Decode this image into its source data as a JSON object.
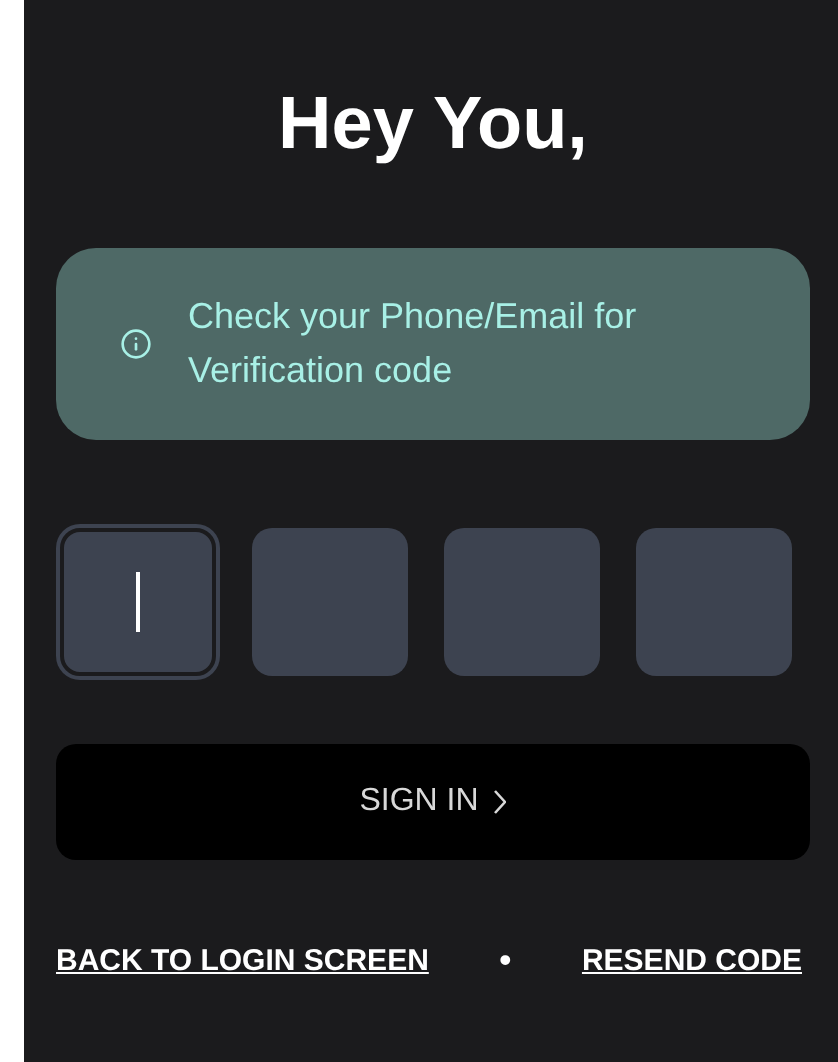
{
  "title": "Hey You,",
  "alert": {
    "text": "Check your Phone/Email for Verification code"
  },
  "code_boxes": [
    {
      "selected": true
    },
    {
      "selected": false
    },
    {
      "selected": false
    },
    {
      "selected": false
    }
  ],
  "sign_in_button": {
    "label": "SIGN IN"
  },
  "links": [
    {
      "label": "BACK TO LOGIN SCREEN"
    },
    {
      "label": "RESEND CODE"
    }
  ],
  "separator": "•"
}
